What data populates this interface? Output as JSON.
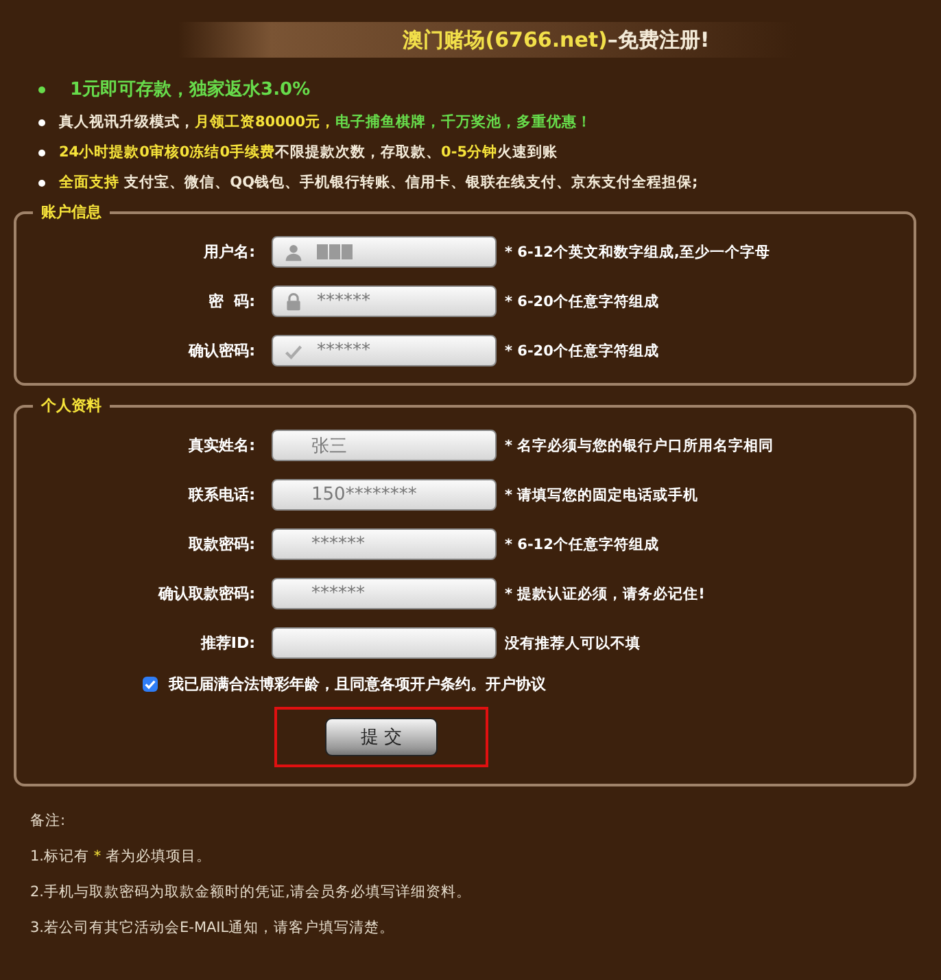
{
  "banner": {
    "title": [
      {
        "kind": "accent",
        "text": "澳门赌场(6766.net)"
      },
      {
        "kind": "plain",
        "text": "–免费注册!"
      }
    ]
  },
  "promos": [
    {
      "kind": "lead",
      "segments": [
        {
          "kind": "green",
          "text": "1元即可存款，独家返水3.0%"
        }
      ]
    },
    {
      "kind": "normal",
      "segments": [
        {
          "kind": "plain",
          "text": "真人视讯升级模式，"
        },
        {
          "kind": "yellow",
          "text": "月领工资80000元，"
        },
        {
          "kind": "green",
          "text": "电子捕鱼棋牌，千万奖池，多重优惠！"
        }
      ]
    },
    {
      "kind": "normal",
      "segments": [
        {
          "kind": "yellow",
          "text": "24小时提款0审核0冻结0手续费"
        },
        {
          "kind": "plain",
          "text": "不限提款次数，存取款、"
        },
        {
          "kind": "yellow",
          "text": "0-5分钟"
        },
        {
          "kind": "plain",
          "text": "火速到账"
        }
      ]
    },
    {
      "kind": "normal",
      "segments": [
        {
          "kind": "yellow",
          "text": "全面支持"
        },
        {
          "kind": "plain",
          "text": " 支付宝、微信、QQ钱包、手机银行转账、信用卡、银联在线支付、京东支付全程担保;"
        }
      ]
    }
  ],
  "account": {
    "legend": "账户信息",
    "fields": [
      {
        "label": "用户名:",
        "value_blurred": true,
        "hint": "* 6-12个英文和数字组成,至少一个字母"
      },
      {
        "label": "密  码:",
        "value": "******",
        "hint": "* 6-20个任意字符组成"
      },
      {
        "label": "确认密码:",
        "value": "******",
        "hint": "* 6-20个任意字符组成"
      }
    ]
  },
  "personal": {
    "legend": "个人资料",
    "fields": [
      {
        "label": "真实姓名:",
        "value": "张三",
        "hint": "* 名字必须与您的银行户口所用名字相同"
      },
      {
        "label": "联系电话:",
        "value": "150********",
        "hint": "* 请填写您的固定电话或手机"
      },
      {
        "label": "取款密码:",
        "value": "******",
        "hint": "* 6-12个任意字符组成"
      },
      {
        "label": "确认取款密码:",
        "value": "******",
        "hint": "* 提款认证必须，请务必记住!"
      },
      {
        "label": "推荐ID:",
        "hint": "没有推荐人可以不填"
      }
    ],
    "agreement": {
      "checked": true,
      "text": "我已届满合法博彩年龄，且同意各项开户条约。开户协议"
    },
    "submit": {
      "label": "提 交",
      "highlighted": true
    }
  },
  "notes": {
    "title": "备注:",
    "items": [
      [
        {
          "kind": "plain",
          "text": "1.标记有 "
        },
        {
          "kind": "yellow",
          "text": "*"
        },
        {
          "kind": "plain",
          "text": " 者为必填项目。"
        }
      ],
      [
        {
          "kind": "plain",
          "text": "2.手机与取款密码为取款金额时的凭证,请会员务必填写详细资料。"
        }
      ],
      [
        {
          "kind": "plain",
          "text": "3.若公司有其它活动会E-MAIL通知，请客户填写清楚。"
        }
      ]
    ]
  }
}
